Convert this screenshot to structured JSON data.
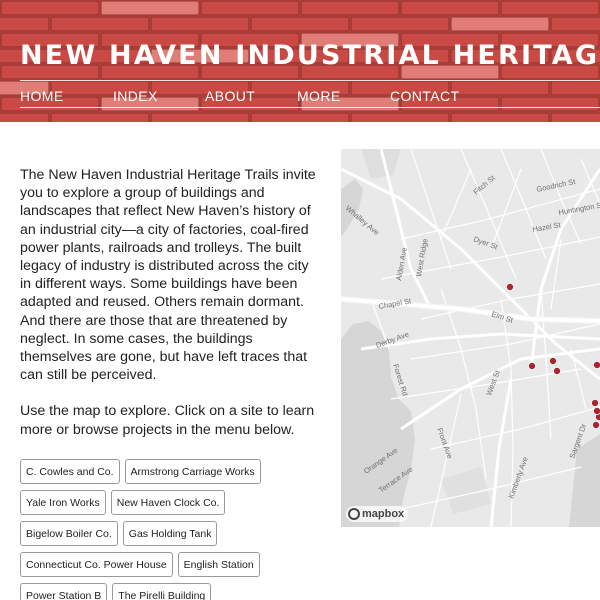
{
  "header": {
    "title": "NEW HAVEN INDUSTRIAL HERITAGE TRAILS",
    "brick_color": "#c94a44",
    "mortar_color": "#8a2f2a",
    "highlight_color": "#e07d77"
  },
  "nav": {
    "items": [
      "HOME",
      "INDEX",
      "ABOUT",
      "MORE",
      "CONTACT"
    ]
  },
  "intro": {
    "paragraph1": "The New Haven Industrial Heritage Trails invite you to explore a group of buildings and landscapes that reflect New Haven’s history of an industrial city—a city of factories, coal-fired power plants, railroads and trolleys. The built legacy of industry is distributed across the city in different ways. Some buildings have been adapted and reused. Others remain dormant. And there are those that are threatened by neglect. In some cases, the buildings themselves are gone, but have left traces that can still be perceived.",
    "paragraph2": "Use the map to explore. Click on a site to learn more or browse projects in the menu below."
  },
  "sites": [
    [
      "C. Cowles and Co.",
      "Armstrong Carriage Works"
    ],
    [
      "Yale Iron Works",
      "New Haven Clock Co."
    ],
    [
      "Bigelow Boiler Co.",
      "Gas Holding Tank"
    ],
    [
      "Connecticut Co. Power House",
      "English Station"
    ],
    [
      "Power Station B",
      "The Pirelli Building"
    ]
  ],
  "map": {
    "marker_color": "#a8262d",
    "attribution": "mapbox",
    "street_labels": {
      "fitch": "Fitch St",
      "goodrich": "Goodrich St",
      "huntington": "Huntington St",
      "whalley": "Whalley Ave",
      "hazel": "Hazel St",
      "dyer": "Dyer St",
      "alden": "Alden Ave",
      "west_ridge": "West Ridge",
      "chapel": "Chapel St",
      "elm": "Elm St",
      "derby": "Derby Ave",
      "forest": "Forest Rd",
      "west": "West St",
      "front": "Front Ave",
      "orange": "Orange Ave",
      "terrace": "Terrace Ave",
      "kimberly": "Kimberly Ave",
      "sargent": "Sargent Dr"
    }
  }
}
